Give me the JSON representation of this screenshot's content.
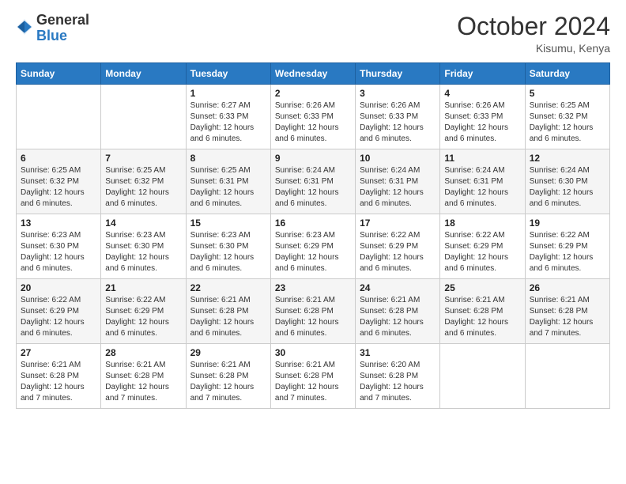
{
  "header": {
    "logo_line1": "General",
    "logo_line2": "Blue",
    "month": "October 2024",
    "location": "Kisumu, Kenya"
  },
  "weekdays": [
    "Sunday",
    "Monday",
    "Tuesday",
    "Wednesday",
    "Thursday",
    "Friday",
    "Saturday"
  ],
  "weeks": [
    [
      {
        "day": "",
        "info": ""
      },
      {
        "day": "",
        "info": ""
      },
      {
        "day": "1",
        "info": "Sunrise: 6:27 AM\nSunset: 6:33 PM\nDaylight: 12 hours and 6 minutes."
      },
      {
        "day": "2",
        "info": "Sunrise: 6:26 AM\nSunset: 6:33 PM\nDaylight: 12 hours and 6 minutes."
      },
      {
        "day": "3",
        "info": "Sunrise: 6:26 AM\nSunset: 6:33 PM\nDaylight: 12 hours and 6 minutes."
      },
      {
        "day": "4",
        "info": "Sunrise: 6:26 AM\nSunset: 6:33 PM\nDaylight: 12 hours and 6 minutes."
      },
      {
        "day": "5",
        "info": "Sunrise: 6:25 AM\nSunset: 6:32 PM\nDaylight: 12 hours and 6 minutes."
      }
    ],
    [
      {
        "day": "6",
        "info": "Sunrise: 6:25 AM\nSunset: 6:32 PM\nDaylight: 12 hours and 6 minutes."
      },
      {
        "day": "7",
        "info": "Sunrise: 6:25 AM\nSunset: 6:32 PM\nDaylight: 12 hours and 6 minutes."
      },
      {
        "day": "8",
        "info": "Sunrise: 6:25 AM\nSunset: 6:31 PM\nDaylight: 12 hours and 6 minutes."
      },
      {
        "day": "9",
        "info": "Sunrise: 6:24 AM\nSunset: 6:31 PM\nDaylight: 12 hours and 6 minutes."
      },
      {
        "day": "10",
        "info": "Sunrise: 6:24 AM\nSunset: 6:31 PM\nDaylight: 12 hours and 6 minutes."
      },
      {
        "day": "11",
        "info": "Sunrise: 6:24 AM\nSunset: 6:31 PM\nDaylight: 12 hours and 6 minutes."
      },
      {
        "day": "12",
        "info": "Sunrise: 6:24 AM\nSunset: 6:30 PM\nDaylight: 12 hours and 6 minutes."
      }
    ],
    [
      {
        "day": "13",
        "info": "Sunrise: 6:23 AM\nSunset: 6:30 PM\nDaylight: 12 hours and 6 minutes."
      },
      {
        "day": "14",
        "info": "Sunrise: 6:23 AM\nSunset: 6:30 PM\nDaylight: 12 hours and 6 minutes."
      },
      {
        "day": "15",
        "info": "Sunrise: 6:23 AM\nSunset: 6:30 PM\nDaylight: 12 hours and 6 minutes."
      },
      {
        "day": "16",
        "info": "Sunrise: 6:23 AM\nSunset: 6:29 PM\nDaylight: 12 hours and 6 minutes."
      },
      {
        "day": "17",
        "info": "Sunrise: 6:22 AM\nSunset: 6:29 PM\nDaylight: 12 hours and 6 minutes."
      },
      {
        "day": "18",
        "info": "Sunrise: 6:22 AM\nSunset: 6:29 PM\nDaylight: 12 hours and 6 minutes."
      },
      {
        "day": "19",
        "info": "Sunrise: 6:22 AM\nSunset: 6:29 PM\nDaylight: 12 hours and 6 minutes."
      }
    ],
    [
      {
        "day": "20",
        "info": "Sunrise: 6:22 AM\nSunset: 6:29 PM\nDaylight: 12 hours and 6 minutes."
      },
      {
        "day": "21",
        "info": "Sunrise: 6:22 AM\nSunset: 6:29 PM\nDaylight: 12 hours and 6 minutes."
      },
      {
        "day": "22",
        "info": "Sunrise: 6:21 AM\nSunset: 6:28 PM\nDaylight: 12 hours and 6 minutes."
      },
      {
        "day": "23",
        "info": "Sunrise: 6:21 AM\nSunset: 6:28 PM\nDaylight: 12 hours and 6 minutes."
      },
      {
        "day": "24",
        "info": "Sunrise: 6:21 AM\nSunset: 6:28 PM\nDaylight: 12 hours and 6 minutes."
      },
      {
        "day": "25",
        "info": "Sunrise: 6:21 AM\nSunset: 6:28 PM\nDaylight: 12 hours and 6 minutes."
      },
      {
        "day": "26",
        "info": "Sunrise: 6:21 AM\nSunset: 6:28 PM\nDaylight: 12 hours and 7 minutes."
      }
    ],
    [
      {
        "day": "27",
        "info": "Sunrise: 6:21 AM\nSunset: 6:28 PM\nDaylight: 12 hours and 7 minutes."
      },
      {
        "day": "28",
        "info": "Sunrise: 6:21 AM\nSunset: 6:28 PM\nDaylight: 12 hours and 7 minutes."
      },
      {
        "day": "29",
        "info": "Sunrise: 6:21 AM\nSunset: 6:28 PM\nDaylight: 12 hours and 7 minutes."
      },
      {
        "day": "30",
        "info": "Sunrise: 6:21 AM\nSunset: 6:28 PM\nDaylight: 12 hours and 7 minutes."
      },
      {
        "day": "31",
        "info": "Sunrise: 6:20 AM\nSunset: 6:28 PM\nDaylight: 12 hours and 7 minutes."
      },
      {
        "day": "",
        "info": ""
      },
      {
        "day": "",
        "info": ""
      }
    ]
  ]
}
